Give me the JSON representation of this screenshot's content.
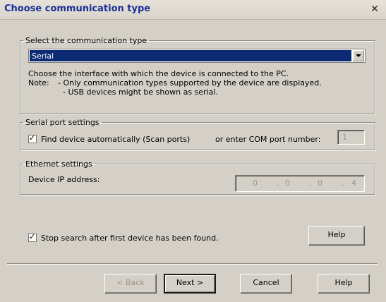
{
  "window": {
    "title": "Choose communication type",
    "close_icon": "close-icon"
  },
  "comm_type": {
    "legend": "Select the communication type",
    "selected": "Serial",
    "description": "Choose the interface with which the device is connected to the PC.",
    "note_label": "Note:",
    "note_line1": "- Only communication types supported by the device are displayed.",
    "note_line2": "- USB devices might be shown as serial."
  },
  "serial": {
    "legend": "Serial port settings",
    "scan_label": "Find device automatically (Scan ports)",
    "scan_checked": true,
    "com_label": "or enter COM port number:",
    "com_value": "1"
  },
  "ethernet": {
    "legend": "Ethernet settings",
    "ip_label": "Device IP address:",
    "ip_octets": [
      "0",
      "0",
      "0",
      "4"
    ]
  },
  "stop_search": {
    "label": "Stop search after first device has been found.",
    "checked": true,
    "help_label": "Help"
  },
  "buttons": {
    "back": "< Back",
    "next": "Next >",
    "cancel": "Cancel",
    "help": "Help"
  }
}
